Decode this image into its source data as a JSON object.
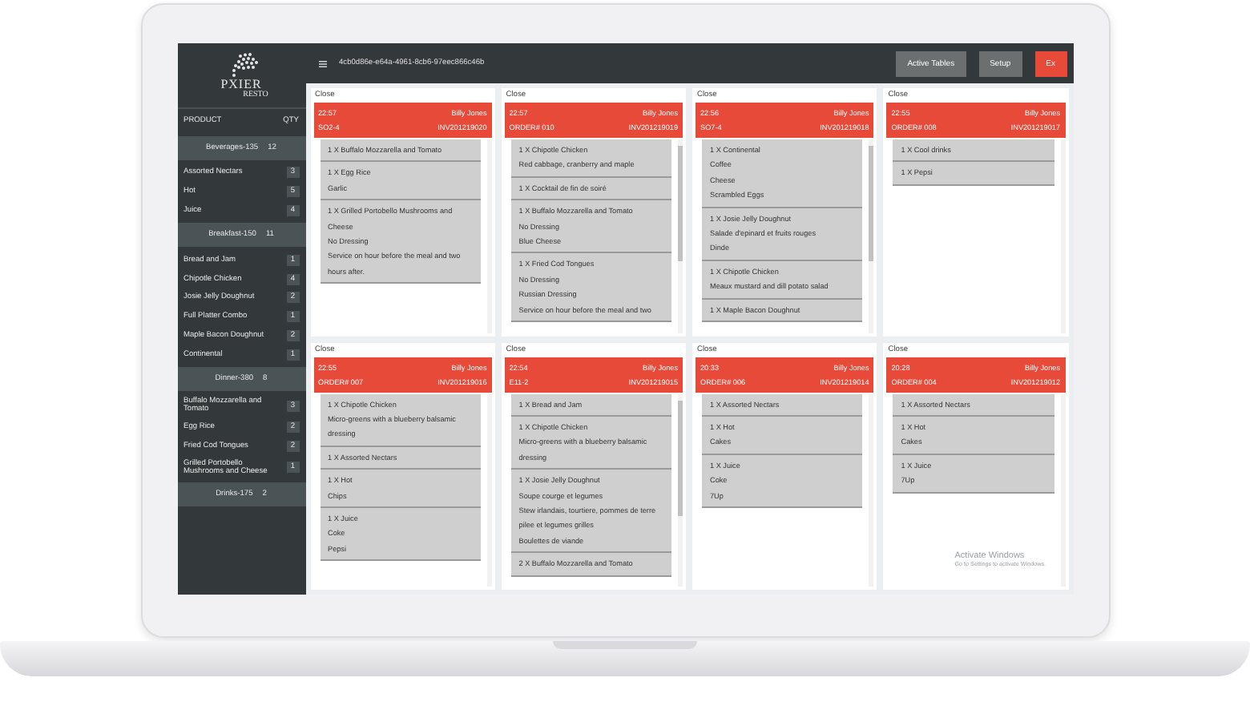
{
  "sidebar": {
    "logo": {
      "name": "PXIER",
      "sub": "RESTO"
    },
    "columns": [
      "PRODUCT",
      "QTY"
    ],
    "groups": [
      {
        "title": "Beverages-135",
        "qty": "12",
        "items": [
          {
            "name": "Assorted Nectars",
            "qty": "3"
          },
          {
            "name": "Hot",
            "qty": "5"
          },
          {
            "name": "Juice",
            "qty": "4"
          }
        ]
      },
      {
        "title": "Breakfast-150",
        "qty": "11",
        "items": [
          {
            "name": "Bread and Jam",
            "qty": "1"
          },
          {
            "name": "Chipotle Chicken",
            "qty": "4"
          },
          {
            "name": "Josie Jelly Doughnut",
            "qty": "2"
          },
          {
            "name": "Full Platter Combo",
            "qty": "1"
          },
          {
            "name": "Maple Bacon Doughnut",
            "qty": "2"
          },
          {
            "name": "Continental",
            "qty": "1"
          }
        ]
      },
      {
        "title": "Dinner-380",
        "qty": "8",
        "items": [
          {
            "name": "Buffalo Mozzarella and Tomato",
            "qty": "3"
          },
          {
            "name": "Egg Rice",
            "qty": "2"
          },
          {
            "name": "Fried Cod Tongues",
            "qty": "2"
          },
          {
            "name": "Grilled Portobello Mushrooms and Cheese",
            "qty": "1"
          }
        ]
      },
      {
        "title": "Drinks-175",
        "qty": "2"
      }
    ]
  },
  "topbar": {
    "title": "4cb0d86e-e64a-4961-8cb6-97eec866c46b",
    "buttons": [
      {
        "label": "Active Tables",
        "kind": "gray"
      },
      {
        "label": "Setup",
        "kind": "gray"
      },
      {
        "label": "Ex",
        "kind": "red"
      }
    ]
  },
  "orders": [
    {
      "close": "Close",
      "time": "22:57",
      "customer": "Billy Jones",
      "table": "SO2-4",
      "invoice": "INV201219020",
      "scrollable": false,
      "items": [
        [
          "1 X Buffalo Mozzarella and Tomato"
        ],
        [
          "1 X Egg Rice",
          "Garlic"
        ],
        [
          "1 X Grilled Portobello Mushrooms and Cheese",
          "No Dressing",
          "Service on hour before the meal and two hours after."
        ]
      ]
    },
    {
      "close": "Close",
      "time": "22:57",
      "customer": "Billy Jones",
      "table": "ORDER# 010",
      "invoice": "INV201219019",
      "scrollable": true,
      "items": [
        [
          "1 X Chipotle Chicken",
          "Red cabbage, cranberry and maple"
        ],
        [
          "1 X Cocktail de fin de soiré"
        ],
        [
          "1 X Buffalo Mozzarella and Tomato",
          "No Dressing",
          "Blue Cheese"
        ],
        [
          "1 X Fried Cod Tongues",
          "No Dressing",
          "Russian Dressing",
          "Service on hour before the meal and two"
        ]
      ]
    },
    {
      "close": "Close",
      "time": "22:56",
      "customer": "Billy Jones",
      "table": "SO7-4",
      "invoice": "INV201219018",
      "scrollable": true,
      "items": [
        [
          "1 X Continental",
          "Coffee",
          "Cheese",
          "Scrambled Eggs"
        ],
        [
          "1 X Josie Jelly Doughnut",
          "Salade d'epinard et fruits rouges",
          "Dinde"
        ],
        [
          "1 X Chipotle Chicken",
          "Meaux mustard and dill potato salad"
        ],
        [
          "1 X Maple Bacon Doughnut"
        ]
      ]
    },
    {
      "close": "Close",
      "time": "22:55",
      "customer": "Billy Jones",
      "table": "ORDER# 008",
      "invoice": "INV201219017",
      "scrollable": false,
      "items": [
        [
          "1 X Cool drinks"
        ],
        [
          "1 X Pepsi"
        ]
      ]
    },
    {
      "close": "Close",
      "time": "22:55",
      "customer": "Billy Jones",
      "table": "ORDER# 007",
      "invoice": "INV201219016",
      "scrollable": false,
      "items": [
        [
          "1 X Chipotle Chicken",
          "Micro-greens with a blueberry balsamic dressing"
        ],
        [
          "1 X Assorted Nectars"
        ],
        [
          "1 X Hot",
          "Chips"
        ],
        [
          "1 X Juice",
          "Coke",
          "Pepsi"
        ]
      ]
    },
    {
      "close": "Close",
      "time": "22:54",
      "customer": "Billy Jones",
      "table": "E11-2",
      "invoice": "INV201219015",
      "scrollable": true,
      "items": [
        [
          "1 X Bread and Jam"
        ],
        [
          "1 X Chipotle Chicken",
          "Micro-greens with a blueberry balsamic dressing"
        ],
        [
          "1 X Josie Jelly Doughnut",
          "Soupe courge et legumes",
          "Stew irlandais, tourtiere, pommes de terre pilee et legumes grilles",
          "Boulettes de viande"
        ],
        [
          "2 X Buffalo Mozzarella and Tomato"
        ]
      ]
    },
    {
      "close": "Close",
      "time": "20:33",
      "customer": "Billy Jones",
      "table": "ORDER# 006",
      "invoice": "INV201219014",
      "scrollable": false,
      "items": [
        [
          "1 X Assorted Nectars"
        ],
        [
          "1 X Hot",
          "Cakes"
        ],
        [
          "1 X Juice",
          "Coke",
          "7Up"
        ]
      ]
    },
    {
      "close": "Close",
      "time": "20:28",
      "customer": "Billy Jones",
      "table": "ORDER# 004",
      "invoice": "INV201219012",
      "scrollable": false,
      "items": [
        [
          "1 X Assorted Nectars"
        ],
        [
          "1 X Hot",
          "Cakes"
        ],
        [
          "1 X Juice",
          "7Up"
        ]
      ]
    }
  ],
  "system_notice": {
    "title": "Activate Windows",
    "text": "Go to Settings to activate Windows."
  }
}
